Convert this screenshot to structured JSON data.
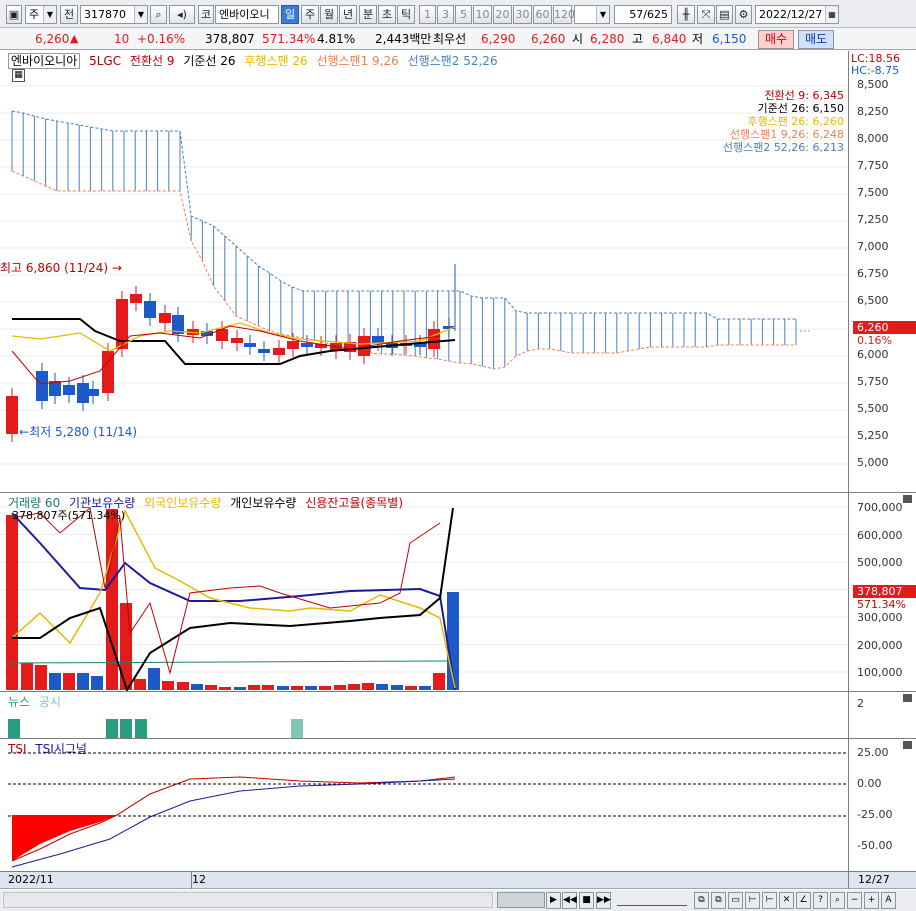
{
  "toolbar": {
    "period_select": "주",
    "market_select": "전",
    "code": "317870",
    "name": "엔바이오니",
    "period_tabs": [
      "일",
      "주",
      "월",
      "년",
      "분",
      "초",
      "틱"
    ],
    "interval_tabs": [
      "1",
      "3",
      "5",
      "10",
      "20",
      "30",
      "60",
      "120"
    ],
    "count": "57",
    "total": "/625",
    "date": "2022/12/27"
  },
  "quote": {
    "price": "6,260",
    "change_arrow": "▲",
    "change": "10",
    "change_pct": "+0.16%",
    "volume": "378,807",
    "volume_ratio": "571.34%",
    "turnover": "4.81%",
    "amount": "2,443백만",
    "ask_label": "최우선",
    "ask": "6,290",
    "bid": "6,260",
    "open_label": "시",
    "open": "6,280",
    "high_label": "고",
    "high": "6,840",
    "low_label": "저",
    "low": "6,150",
    "buy_label": "매수",
    "sell_label": "매도"
  },
  "price_pane": {
    "legend": [
      {
        "text": "엔바이오니아",
        "color": "#000000"
      },
      {
        "text": "5LGC",
        "color": "#b00000"
      },
      {
        "text": "전환선 9",
        "color": "#c00000"
      },
      {
        "text": "기준선 26",
        "color": "#000000"
      },
      {
        "text": "후행스팬 26",
        "color": "#e6b800"
      },
      {
        "text": "선행스팬1 9,26",
        "color": "#f08050"
      },
      {
        "text": "선행스팬2 52,26",
        "color": "#4a7fc0"
      }
    ],
    "lc": "LC:18.56",
    "hc": "HC:-8.75",
    "values": [
      {
        "text": "전환선 9: 6,345",
        "color": "#b00000"
      },
      {
        "text": "기준선 26: 6,150",
        "color": "#000000"
      },
      {
        "text": "후행스팬 26: 6,260",
        "color": "#e6b800"
      },
      {
        "text": "선행스팬1 9,26: 6,248",
        "color": "#f08050"
      },
      {
        "text": "선행스팬2 52,26: 6,213",
        "color": "#4a7fc0"
      }
    ],
    "high_note": "최고 6,860 (11/24)",
    "low_note": "최저 5,280 (11/14)",
    "ticks": [
      "8,500",
      "8,250",
      "8,000",
      "7,750",
      "7,500",
      "7,250",
      "7,000",
      "6,750",
      "6,500",
      "6,250",
      "6,000",
      "5,750",
      "5,500",
      "5,250",
      "5,000"
    ],
    "price_tag": "6,260",
    "pct_tag": "0.16%"
  },
  "volume_pane": {
    "legend": [
      {
        "text": "거래량 60",
        "color": "#1a7f6a"
      },
      {
        "text": "기관보유수량",
        "color": "#1a1aa0"
      },
      {
        "text": "외국인보유수량",
        "color": "#e6b800"
      },
      {
        "text": "개인보유수량",
        "color": "#000000"
      },
      {
        "text": "신용잔고율(종목별)",
        "color": "#c00000"
      }
    ],
    "note": "378,807주(571.34%)",
    "ticks": [
      "700,000",
      "600,000",
      "500,000",
      "400,000",
      "300,000",
      "200,000",
      "100,000"
    ],
    "vol_tag": "378,807",
    "ratio_tag": "571.34%"
  },
  "news_pane": {
    "legend": [
      {
        "text": "뉴스",
        "color": "#2a9d7e"
      },
      {
        "text": "공시",
        "color": "#7fc7b0"
      }
    ],
    "tick": "2"
  },
  "tsi_pane": {
    "legend": [
      {
        "text": "TSI",
        "color": "#c00000"
      },
      {
        "text": "TSI시그널",
        "color": "#1a1aa0"
      }
    ],
    "ticks": [
      "25.00",
      "0.00",
      "-25.00",
      "-50.00"
    ]
  },
  "date_axis": {
    "start": "2022/11",
    "mid": "12",
    "end": "12/27"
  },
  "colors": {
    "up": "#e31b1b",
    "down": "#1d59c9",
    "accent": "#3d7ad6"
  }
}
